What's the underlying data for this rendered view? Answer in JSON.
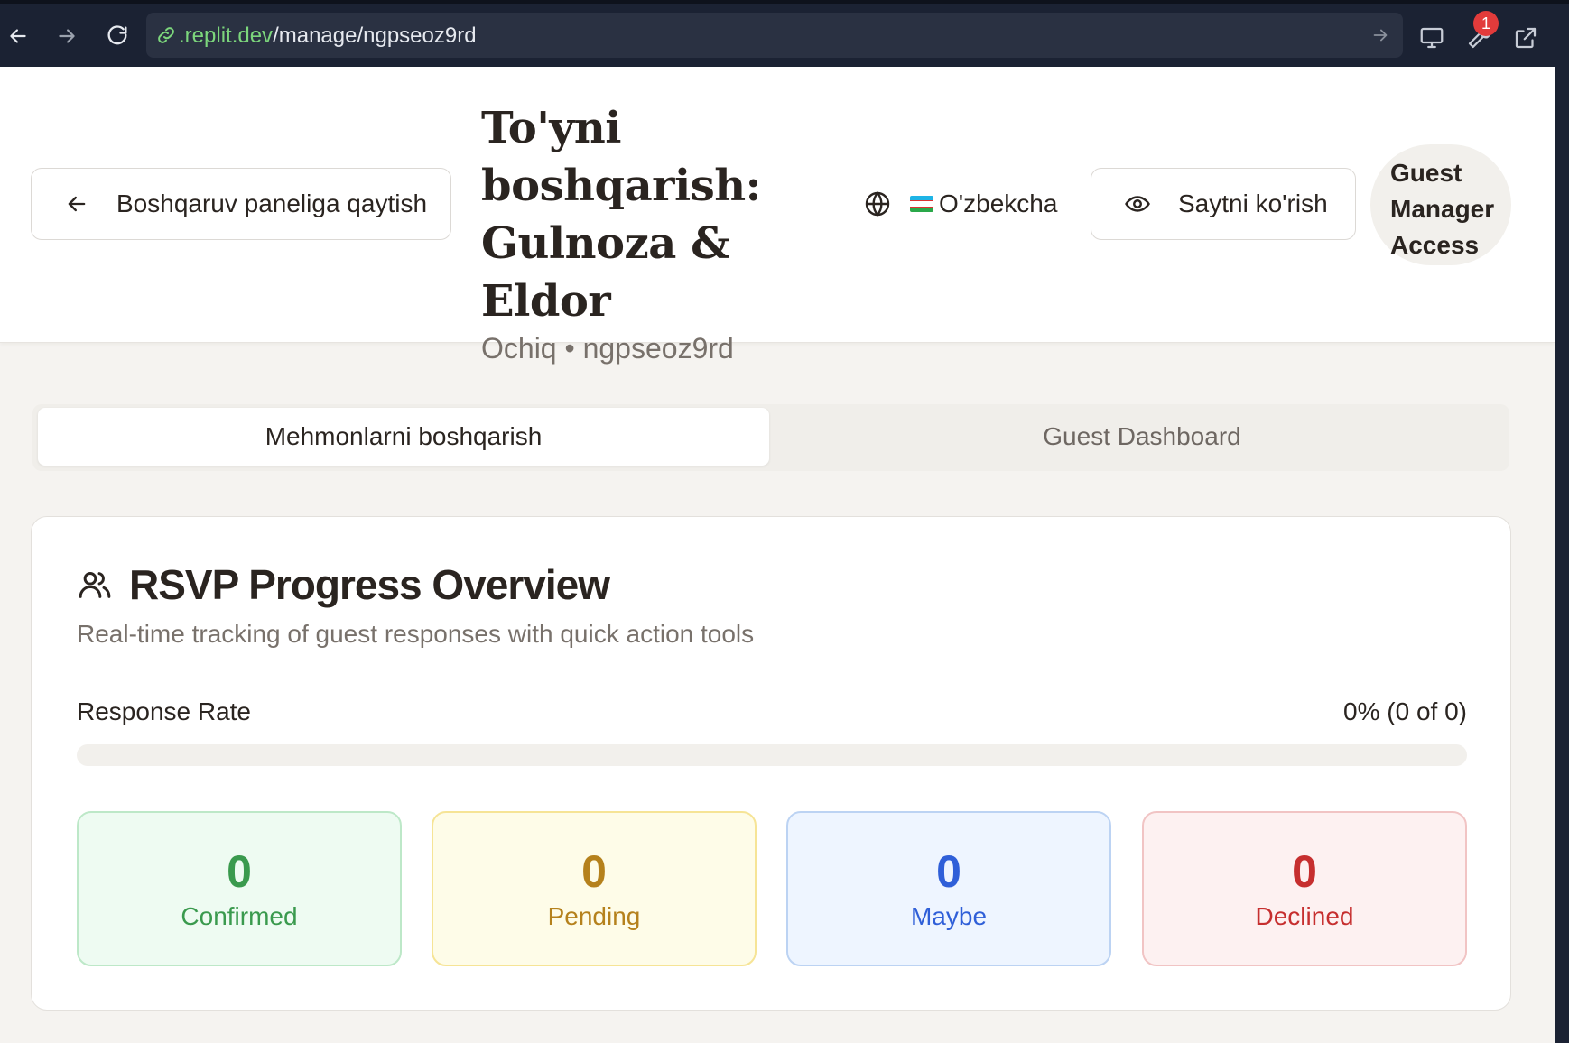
{
  "browser": {
    "url_domain": ".replit.dev",
    "url_path": "/manage/ngpseoz9rd",
    "notification_count": "1"
  },
  "header": {
    "back_label": "Boshqaruv paneliga qaytish",
    "title": "To'yni boshqarish: Gulnoza & Eldor",
    "subtitle": "Ochiq • ngpseoz9rd",
    "language": "O'zbekcha",
    "view_site_label": "Saytni ko'rish",
    "guest_manager_label": "Guest Manager Access"
  },
  "tabs": [
    {
      "label": "Mehmonlarni boshqarish",
      "active": true
    },
    {
      "label": "Guest Dashboard",
      "active": false
    }
  ],
  "card": {
    "title": "RSVP Progress Overview",
    "description": "Real-time tracking of guest responses with quick action tools",
    "response_rate_label": "Response Rate",
    "response_rate_value": "0% (0 of 0)",
    "response_rate_fraction": 0
  },
  "stats": [
    {
      "value": "0",
      "label": "Confirmed",
      "color": "#3a9a4e",
      "bg": "#eefbf2",
      "border": "#bde8c8"
    },
    {
      "value": "0",
      "label": "Pending",
      "color": "#b5811c",
      "bg": "#fefce8",
      "border": "#f6e496"
    },
    {
      "value": "0",
      "label": "Maybe",
      "color": "#2f5fd8",
      "bg": "#eef5ff",
      "border": "#bcd3f3"
    },
    {
      "value": "0",
      "label": "Declined",
      "color": "#c62f2f",
      "bg": "#fdf1f1",
      "border": "#f1c4c4"
    }
  ]
}
